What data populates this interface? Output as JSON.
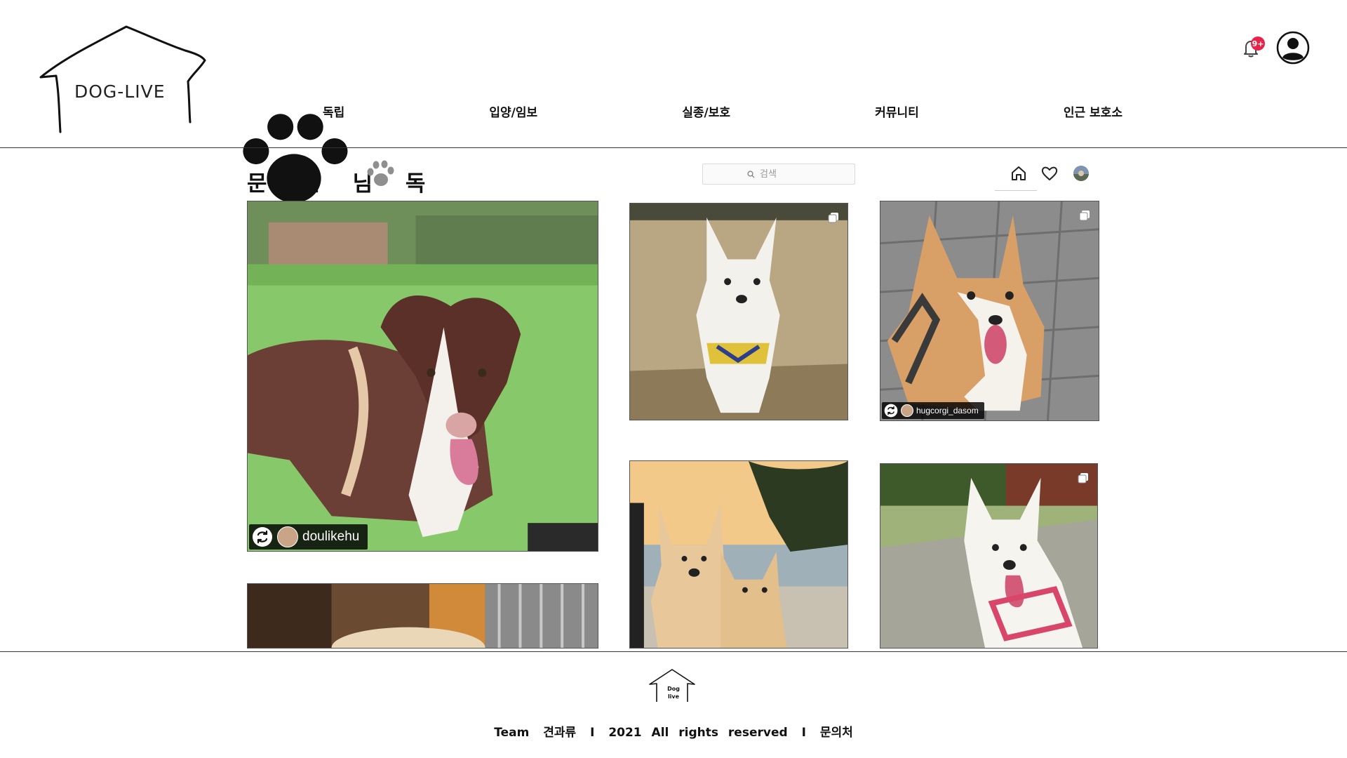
{
  "brand": {
    "logo_text": "DOG-LIVE"
  },
  "nav": {
    "items": [
      {
        "label": "독립"
      },
      {
        "label": "입양/임보"
      },
      {
        "label": "실종/보호"
      },
      {
        "label": "커뮤니티"
      },
      {
        "label": "인근 보호소"
      }
    ]
  },
  "notifications": {
    "badge": "9+"
  },
  "feed": {
    "title": "문 신 님 독",
    "search_placeholder": "검색"
  },
  "photos": [
    {
      "credit_user": "doulikehu"
    },
    {
      "credit_user": "hugcorgi_dasom"
    }
  ],
  "footer": {
    "logo_line1": "Dog",
    "logo_line2": "live",
    "team": "Team",
    "team_name": "견과류",
    "sep1": "I",
    "rights": "2021 All rights reserved",
    "sep2": "I",
    "contact": "문의처"
  },
  "colors": {
    "badge": "#e8244a",
    "grass": "#7fc46a",
    "dirt": "#b7a07c"
  },
  "icons": [
    "bell-icon",
    "user-avatar-icon",
    "home-icon",
    "heart-icon",
    "profile-thumb",
    "search-icon",
    "paw-icon",
    "multi-photo-icon",
    "repost-icon"
  ]
}
